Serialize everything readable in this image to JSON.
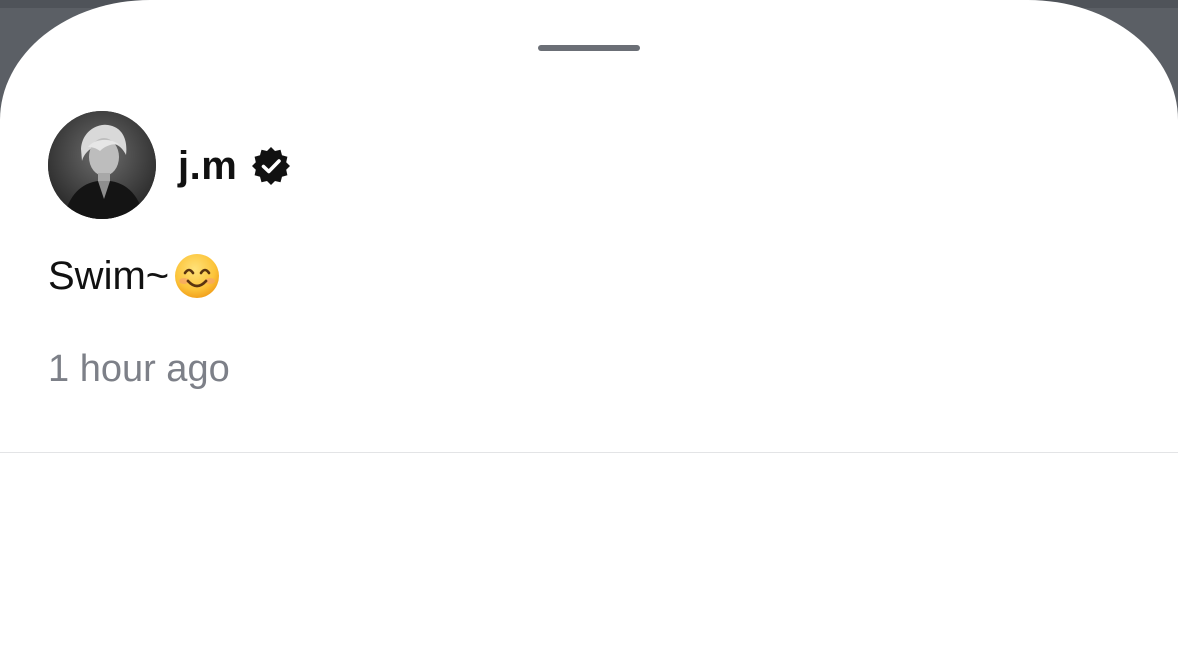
{
  "sheet": {
    "grabber_icon": "drag-handle"
  },
  "post": {
    "author": {
      "username": "j.m",
      "verified": true,
      "verified_icon": "verified-badge-icon",
      "avatar_icon": "profile-photo-grayscale"
    },
    "text": "Swim~",
    "emoji": "😊",
    "emoji_name": "smiling-face-with-smiling-eyes",
    "timestamp": "1 hour ago"
  },
  "colors": {
    "primary_text": "#111111",
    "secondary_text": "#7d8088",
    "sheet_background": "#ffffff",
    "backdrop": "#5b5f65",
    "divider": "#e3e4e6"
  }
}
